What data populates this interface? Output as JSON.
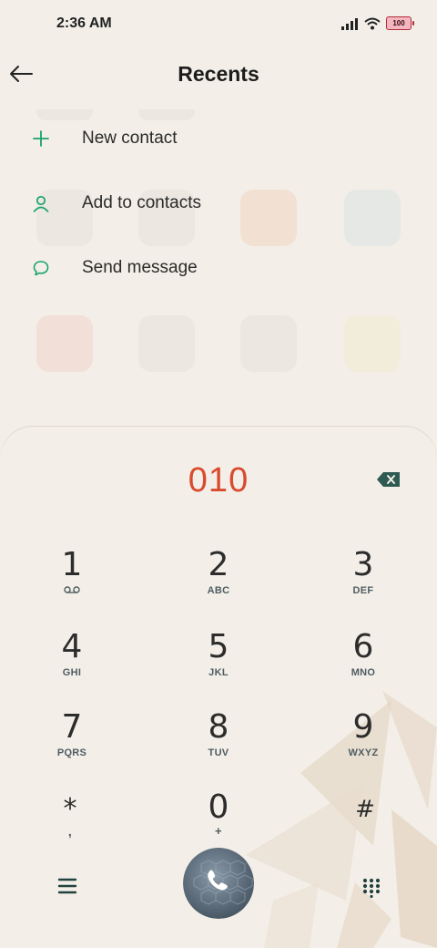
{
  "status_bar": {
    "time": "2:36 AM",
    "battery_level": "100",
    "icons": [
      "signal-icon",
      "wifi-icon",
      "battery-icon"
    ]
  },
  "header": {
    "title": "Recents",
    "back_icon": "arrow-left-icon"
  },
  "menu": [
    {
      "label": "New contact",
      "icon": "plus-icon"
    },
    {
      "label": "Add to contacts",
      "icon": "person-icon"
    },
    {
      "label": "Send message",
      "icon": "message-bubble-icon"
    }
  ],
  "dialer": {
    "number": "010",
    "keys": [
      {
        "digit": "1",
        "letters": ""
      },
      {
        "digit": "2",
        "letters": "ABC"
      },
      {
        "digit": "3",
        "letters": "DEF"
      },
      {
        "digit": "4",
        "letters": "GHI"
      },
      {
        "digit": "5",
        "letters": "JKL"
      },
      {
        "digit": "6",
        "letters": "MNO"
      },
      {
        "digit": "7",
        "letters": "PQRS"
      },
      {
        "digit": "8",
        "letters": "TUV"
      },
      {
        "digit": "9",
        "letters": "WXYZ"
      },
      {
        "digit": "*",
        "letters": ","
      },
      {
        "digit": "0",
        "letters": "+"
      },
      {
        "digit": "#",
        "letters": ""
      }
    ]
  },
  "colors": {
    "accent_green": "#1aa36b",
    "number_red": "#d94b2e",
    "dark_teal": "#21423f",
    "background": "#f3efe8"
  }
}
